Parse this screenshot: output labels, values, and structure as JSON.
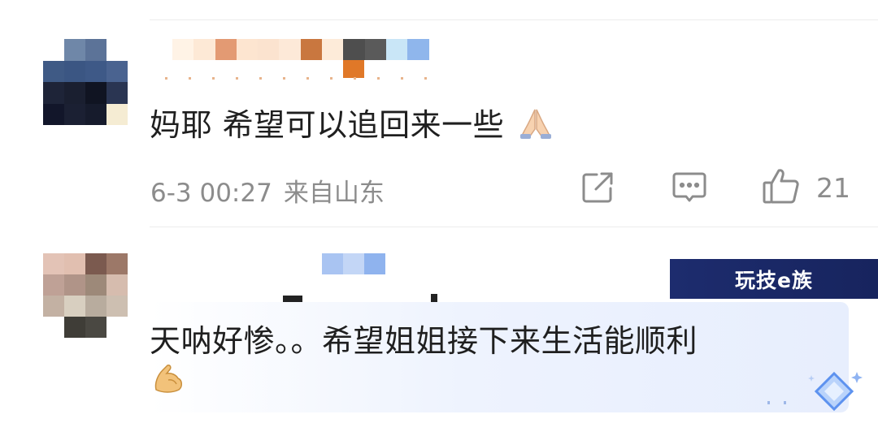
{
  "comments": [
    {
      "text": "妈耶 希望可以追回来一些",
      "emoji": "folded-hands",
      "timestamp": "6-3 00:27",
      "location": "来自山东",
      "like_count": "21"
    },
    {
      "text_line1": "天呐好惨。。希望姐姐接下来生活能顺利",
      "emoji": "flexed-biceps"
    }
  ],
  "watermark": {
    "text": "玩技e族"
  },
  "colors": {
    "meta_gray": "#8c8c8c",
    "text_dark": "#1f1f1f",
    "banner_navy": "#1d2c6e",
    "card_tint": "#e7eefd"
  },
  "icons": [
    "share-icon",
    "comment-icon",
    "like-icon",
    "diamond-sparkle-icon"
  ]
}
